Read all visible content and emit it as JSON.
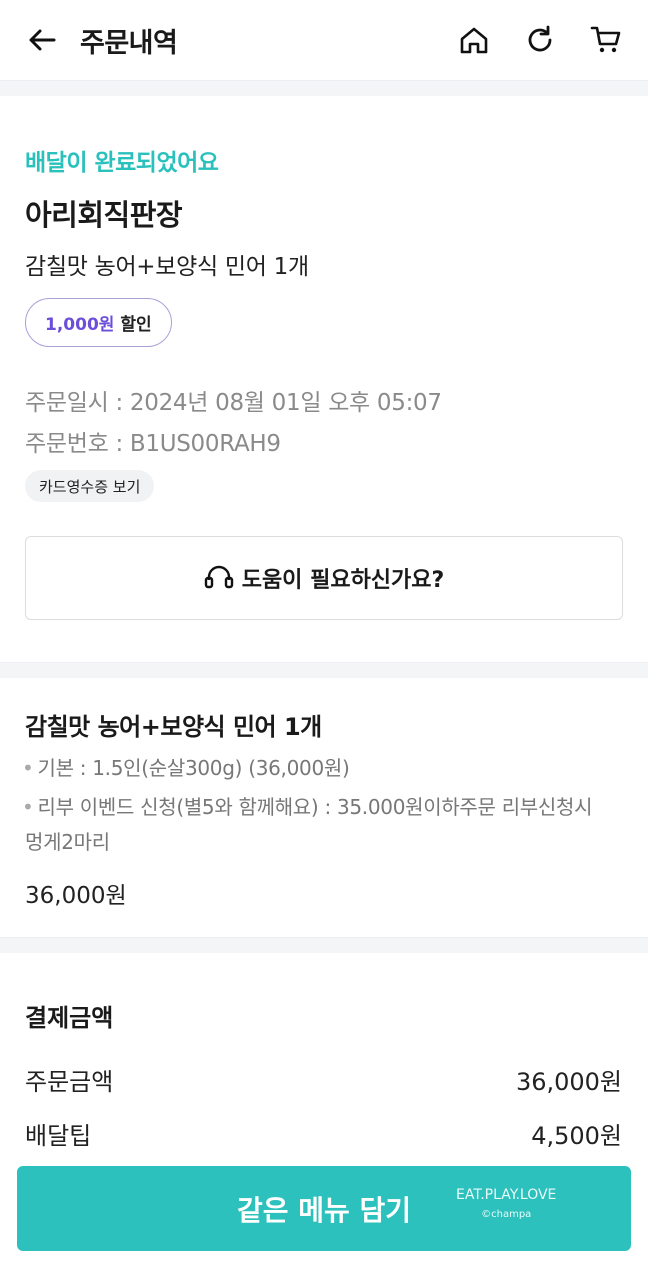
{
  "header": {
    "title": "주문내역",
    "back_icon": "back-arrow-icon",
    "icons": [
      "home-icon",
      "refresh-icon",
      "cart-icon"
    ]
  },
  "order": {
    "status": "배달이 완료되었어요",
    "store_name": "아리회직판장",
    "menu_summary": "감칠맛 농어+보양식 민어 1개",
    "discount_amount": "1,000원",
    "discount_label": "할인",
    "order_date": "주문일시 : 2024년 08월 01일 오후 05:07",
    "order_number": "주문번호 : B1US00RAH9",
    "receipt_button": "카드영수증 보기",
    "help_label": "도움이 필요하신가요?"
  },
  "item": {
    "title": "감칠맛 농어+보양식 민어 1개",
    "options": [
      "기본 : 1.5인(순살300g) (36,000원)",
      "리부 이벤드 신청(별5와 함께해요) : 35.000원이하주문 리부신청시",
      "멍게2마리"
    ],
    "price": "36,000원"
  },
  "payment": {
    "title": "결제금액",
    "rows": [
      {
        "label": "주문금액",
        "value": "36,000원"
      },
      {
        "label": "배달팁",
        "value": "4,500원"
      }
    ]
  },
  "cta": {
    "label": "같은 메뉴 담기"
  },
  "watermark": {
    "line1": "EAT.PLAY.LOVE",
    "line2": "©champa"
  },
  "colors": {
    "accent": "#2ac1bc",
    "discount_text": "#6b4fd8"
  }
}
